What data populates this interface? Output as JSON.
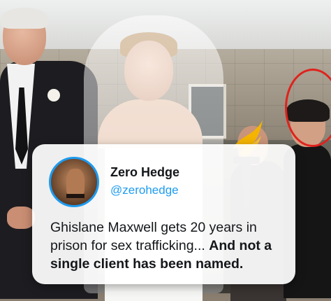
{
  "tweet": {
    "display_name": "Zero Hedge",
    "handle": "@zerohedge",
    "text_plain": "Ghislane Maxwell gets 20 years in prison for sex trafficking... ",
    "text_bold": "And not a single client has been named."
  },
  "colors": {
    "handle_blue": "#1d9bf0",
    "avatar_ring": "#1d9bf0",
    "highlight_circle": "#e0221c",
    "torch_flame": "#f5b400",
    "torch_handle": "#3b3f47"
  },
  "icons": {
    "logo": "torch-logo-icon"
  }
}
